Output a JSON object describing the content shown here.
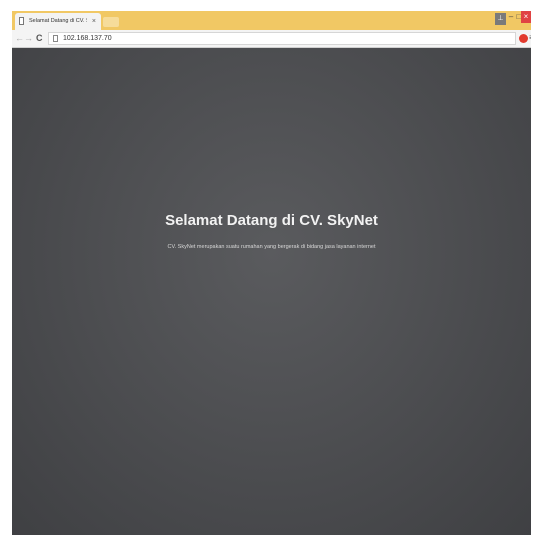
{
  "browser": {
    "tab": {
      "title": "Selamat Datang di CV. Sk",
      "close_label": "×"
    },
    "window_controls": {
      "user_label": "⊥",
      "minimize_label": "–",
      "maximize_label": "□",
      "close_label": "×"
    },
    "toolbar": {
      "back_label": "←",
      "forward_label": "→",
      "reload_label": "C",
      "url": "102.168.137.70",
      "menu_label": "≡"
    },
    "colors": {
      "titlebar": "#f1c864",
      "page_background": "#4e4f52",
      "close_button": "#e04343"
    }
  },
  "page": {
    "heading": "Selamat Datang di CV. SkyNet",
    "subtitle": "CV. SkyNet merupakan suatu rumahan yang bergerak di bidang jasa layanan internet"
  }
}
